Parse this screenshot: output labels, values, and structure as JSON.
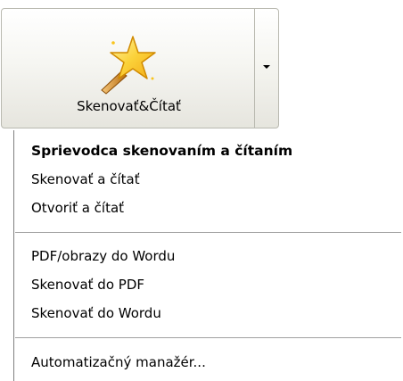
{
  "button": {
    "label": "Skenovať&Čítať",
    "icon": "magic-wand-star-icon",
    "dropdown_icon": "dropdown-arrow-icon"
  },
  "menu": {
    "items": [
      {
        "label": "Sprievodca skenovaním a čítaním",
        "bold": true
      },
      {
        "label": "Skenovať a čítať"
      },
      {
        "label": "Otvoriť a čítať"
      },
      {
        "label": "PDF/obrazy do Wordu"
      },
      {
        "label": "Skenovať do PDF"
      },
      {
        "label": "Skenovať do Wordu"
      },
      {
        "label": "Automatizačný manažér..."
      }
    ]
  },
  "colors": {
    "star_fill": "#f9c41c",
    "star_edge": "#d08a00",
    "wand": "#c47a12"
  }
}
